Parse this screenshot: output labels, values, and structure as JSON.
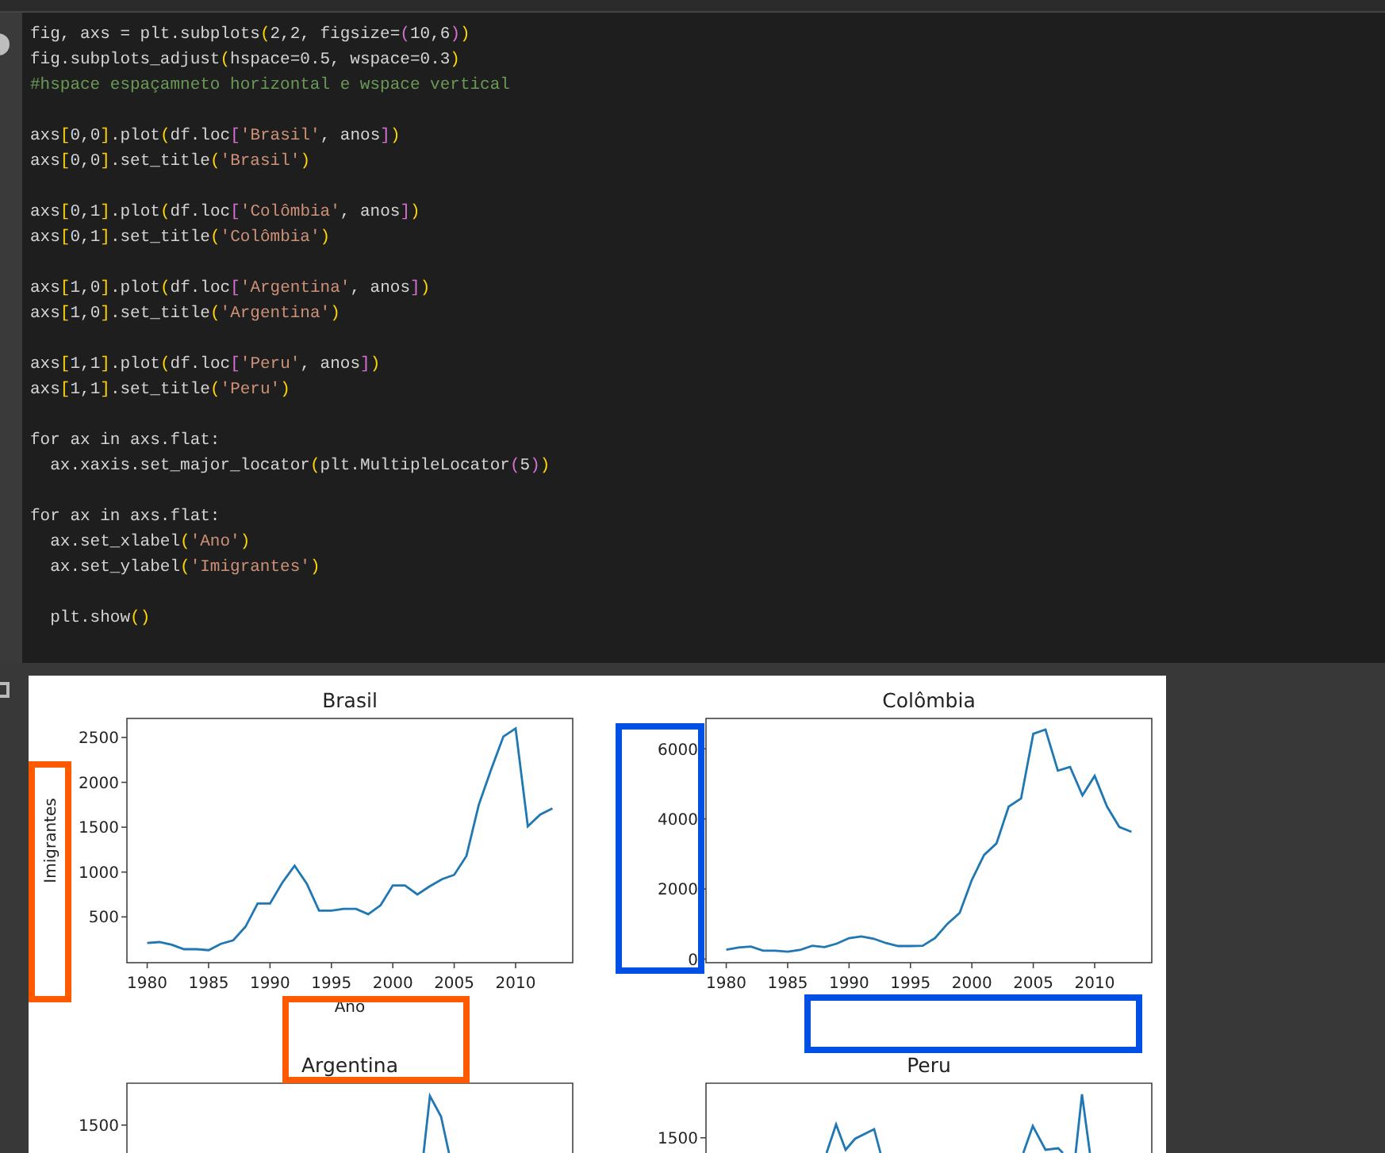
{
  "code_cell": {
    "blocks": [
      [
        "fig, axs = plt.subplots(2,2, figsize=(10,6))",
        "fig.subplots_adjust(hspace=0.5, wspace=0.3)",
        "#hspace espaçamneto horizontal e wspace vertical"
      ],
      [
        "axs[0,0].plot(df.loc['Brasil', anos])",
        "axs[0,0].set_title('Brasil')"
      ],
      [
        "axs[0,1].plot(df.loc['Colômbia', anos])",
        "axs[0,1].set_title('Colômbia')"
      ],
      [
        "axs[1,0].plot(df.loc['Argentina', anos])",
        "axs[1,0].set_title('Argentina')"
      ],
      [
        "axs[1,1].plot(df.loc['Peru', anos])",
        "axs[1,1].set_title('Peru')"
      ],
      [
        "for ax in axs.flat:",
        "  ax.xaxis.set_major_locator(plt.MultipleLocator(5))"
      ],
      [
        "for ax in axs.flat:",
        "  ax.set_xlabel('Ano')",
        "  ax.set_ylabel('Imigrantes')"
      ],
      [
        "  plt.show()"
      ]
    ]
  },
  "figure": {
    "subplots": [
      {
        "kind": "chart",
        "chart_data": {
          "type": "line",
          "title": "Brasil",
          "xlabel": "Ano",
          "ylabel": "Imigrantes",
          "x": [
            1980,
            1981,
            1982,
            1983,
            1984,
            1985,
            1986,
            1987,
            1988,
            1989,
            1990,
            1991,
            1992,
            1993,
            1994,
            1995,
            1996,
            1997,
            1998,
            1999,
            2000,
            2001,
            2002,
            2003,
            2004,
            2005,
            2006,
            2007,
            2008,
            2009,
            2010,
            2011,
            2012,
            2013
          ],
          "series": [
            {
              "color": "#1f77b4",
              "values": [
                210,
                220,
                190,
                140,
                140,
                130,
                200,
                240,
                390,
                650,
                650,
                880,
                1070,
                870,
                570,
                570,
                590,
                590,
                530,
                630,
                850,
                850,
                750,
                840,
                920,
                970,
                1180,
                1750,
                2140,
                2510,
                2600,
                1510,
                1640,
                1710
              ]
            }
          ],
          "xlim": [
            1978.35,
            2014.65
          ],
          "ylim": [
            -10,
            2712
          ],
          "xticks": [
            1980,
            1985,
            1990,
            1995,
            2000,
            2005,
            2010
          ],
          "yticks": [
            500,
            1000,
            1500,
            2000,
            2500
          ]
        }
      },
      {
        "kind": "chart",
        "chart_data": {
          "type": "line",
          "title": "Colômbia",
          "x": [
            1980,
            1981,
            1982,
            1983,
            1984,
            1985,
            1986,
            1987,
            1988,
            1989,
            1990,
            1991,
            1992,
            1993,
            1994,
            1995,
            1996,
            1997,
            1998,
            1999,
            2000,
            2001,
            2002,
            2003,
            2004,
            2005,
            2006,
            2007,
            2008,
            2009,
            2010,
            2011,
            2012,
            2013
          ],
          "series": [
            {
              "color": "#1f77b4",
              "values": [
                270,
                330,
                360,
                240,
                240,
                210,
                260,
                380,
                340,
                440,
                600,
                650,
                580,
                460,
                370,
                370,
                380,
                600,
                1000,
                1320,
                2260,
                2970,
                3300,
                4350,
                4580,
                6430,
                6550,
                5380,
                5480,
                4670,
                5230,
                4360,
                3770,
                3630
              ]
            }
          ],
          "xlim": [
            1978.35,
            2014.65
          ],
          "ylim": [
            -103,
            6867
          ],
          "xticks": [
            1980,
            1985,
            1990,
            1995,
            2000,
            2005,
            2010
          ],
          "yticks": [
            0,
            2000,
            4000,
            6000
          ]
        }
      },
      {
        "kind": "partial",
        "title": "Argentina",
        "ytick_labels": [
          "1500"
        ]
      },
      {
        "kind": "partial",
        "title": "Peru",
        "ytick_labels": [
          "1500"
        ]
      }
    ]
  },
  "annotations": [
    {
      "color": "#ff5a00"
    },
    {
      "color": "#ff5a00"
    },
    {
      "color": "#0050e6"
    },
    {
      "color": "#0050e6"
    }
  ]
}
